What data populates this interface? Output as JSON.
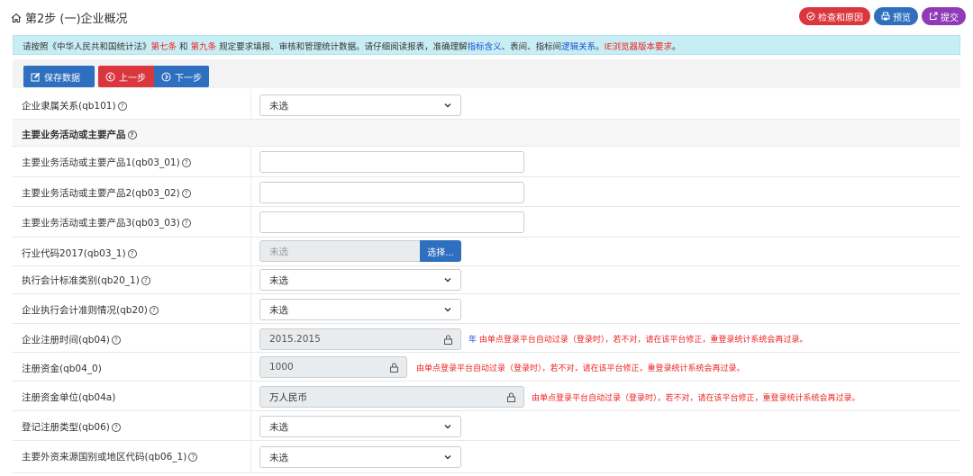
{
  "header": {
    "title": "第2步 (一)企业概况",
    "buttons": {
      "check": "检查和原因",
      "preview": "预览",
      "submit": "提交"
    }
  },
  "notice": {
    "p1": "请按照《中华人民共和国统计法》",
    "r1": "第七条",
    "p2": " 和 ",
    "r2": "第九条",
    "p3": " 规定要求填报、审核和管理统计数据。请仔细阅读报表，准确理解",
    "b1": "指标含义",
    "p4": "、表间、指标间",
    "b2": "逻辑关系",
    "p5": "。",
    "r3": "IE浏览器版本要求",
    "p6": "。"
  },
  "toolbar": {
    "save": "保存数据",
    "prev": "上一步",
    "next": "下一步"
  },
  "form": {
    "qb101": {
      "label": "企业隶属关系(qb101)",
      "value": "未选"
    },
    "section": {
      "label": "主要业务活动或主要产品"
    },
    "qb03_01": {
      "label": "主要业务活动或主要产品1(qb03_01)",
      "value": ""
    },
    "qb03_02": {
      "label": "主要业务活动或主要产品2(qb03_02)",
      "value": ""
    },
    "qb03_03": {
      "label": "主要业务活动或主要产品3(qb03_03)",
      "value": ""
    },
    "qb03_1": {
      "label": "行业代码2017(qb03_1)",
      "value": "未选",
      "button": "选择..."
    },
    "qb20_1": {
      "label": "执行会计标准类别(qb20_1)",
      "value": "未选"
    },
    "qb20": {
      "label": "企业执行会计准则情况(qb20)",
      "value": "未选"
    },
    "qb04": {
      "label": "企业注册时间(qb04)",
      "value": "2015.2015",
      "unit": "年",
      "hint": "由单点登录平台自动过录（登录时），若不对，请在该平台修正，重登录统计系统会再过录。"
    },
    "qb04_0": {
      "label": "注册资金(qb04_0)",
      "value": "1000",
      "hint": "由单点登录平台自动过录（登录时），若不对，请在该平台修正，重登录统计系统会再过录。"
    },
    "qb04a": {
      "label": "注册资金单位(qb04a)",
      "value": "万人民币",
      "hint": "由单点登录平台自动过录（登录时），若不对，请在该平台修正，重登录统计系统会再过录。"
    },
    "qb06": {
      "label": "登记注册类型(qb06)",
      "value": "未选"
    },
    "qb06_1": {
      "label": "主要外资来源国别或地区代码(qb06_1)",
      "value": "未选"
    }
  },
  "colors": {
    "blue": "#2e6fc0",
    "red": "#d9363e",
    "purple": "#8e3bb5",
    "notice_bg": "#c8eef5"
  }
}
